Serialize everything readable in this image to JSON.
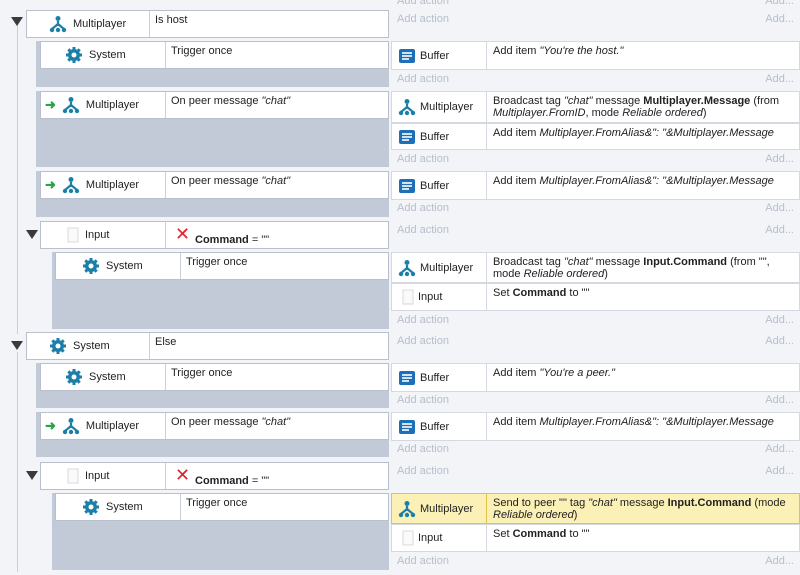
{
  "add_action": "Add action",
  "add_short": "Add...",
  "objects": {
    "multiplayer": "Multiplayer",
    "system": "System",
    "buffer": "Buffer",
    "input": "Input"
  },
  "conditions": {
    "is_host": "Is host",
    "trigger_once": "Trigger once",
    "on_peer_message": "On peer message ",
    "chat_quoted": "\"chat\"",
    "command_name": "Command",
    "equals_empty": " = \"\"",
    "else": "Else"
  },
  "actions": {
    "add_youre_host_pre": "Add item ",
    "add_youre_host_val": "\"You're the host.\"",
    "broadcast1_a": "Broadcast tag ",
    "chat_quoted": "\"chat\"",
    "message": " message ",
    "mp_message": "Multiplayer.Message",
    "from_open": " (from ",
    "mp_fromid": "Multiplayer.FromID",
    "mode": ", mode ",
    "reliable_ordered": "Reliable ordered",
    "close": ")",
    "add_item": "Add item ",
    "fromalias": "Multiplayer.FromAlias&\": \"&Multiplayer.Message",
    "input_command": "Input.Command",
    "from_empty": " (from \"\",",
    "mode_cont": "mode ",
    "set": "Set ",
    "command": "Command",
    "to_empty": " to \"\"",
    "add_youre_peer_val": "\"You're a peer.\"",
    "send_to_peer": "Send to peer \"\" tag ",
    "mode_open": " (mode",
    "reliable_ordered_close": "Reliable ordered",
    "close2": ")"
  }
}
